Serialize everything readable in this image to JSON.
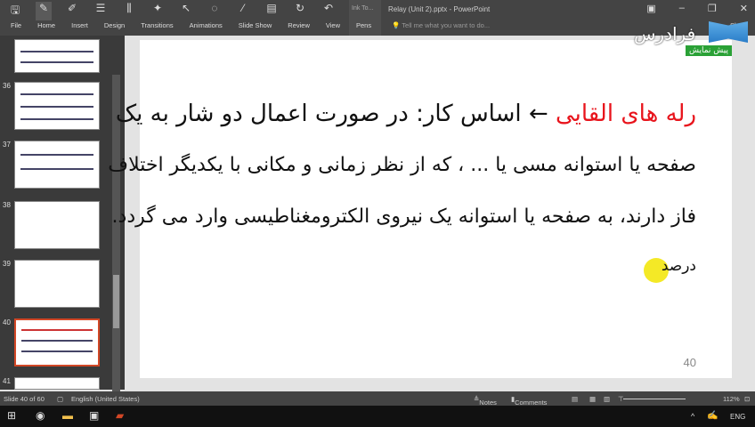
{
  "app": {
    "title": "Relay (Unit 2).pptx - PowerPoint",
    "ink_tools": "Ink To...",
    "tell_me": "Tell me what you want to do...",
    "share": "Share"
  },
  "ribbon_tabs": [
    "File",
    "Home",
    "Insert",
    "Design",
    "Transitions",
    "Animations",
    "Slide Show",
    "Review",
    "View",
    "Pens"
  ],
  "thumbnails": [
    {
      "num": "36"
    },
    {
      "num": "37"
    },
    {
      "num": "38"
    },
    {
      "num": "39"
    },
    {
      "num": "40",
      "active": true
    },
    {
      "num": "41"
    }
  ],
  "slide": {
    "line1_red": "رله های القایی",
    "line1_rest": "← اساس کار: در صورت اعمال دو شار به یک",
    "line2": "صفحه یا استوانه مسی یا ... ، که از نظر زمانی و مکانی با یکدیگر اختلاف",
    "line3": "فاز دارند، به صفحه یا استوانه یک نیروی الکترومغناطیسی وارد می گردد.",
    "line4": "درصد",
    "page_number": "40"
  },
  "watermark": {
    "name": "فرادرس",
    "badge": "پیش نمایش"
  },
  "status": {
    "slide": "Slide 40 of 60",
    "language": "English (United States)",
    "notes": "Notes",
    "comments": "Comments",
    "zoom": "112%"
  },
  "taskbar": {
    "lang": "ENG"
  }
}
